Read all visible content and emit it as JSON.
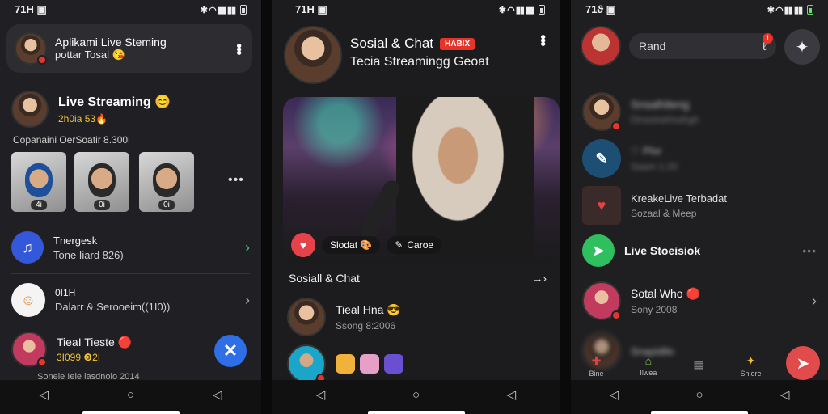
{
  "screen1": {
    "status": {
      "time": "71H ▣"
    },
    "top_card": {
      "title": "Aplikami Live Steming",
      "subtitle": "pottar Tosal 😘"
    },
    "section": {
      "title": "Live Streaming 😊",
      "meta": "2h0ia 53🔥",
      "caption": "Copanaini OerSoatir 8.300i"
    },
    "thumbs": [
      {
        "count": "4i"
      },
      {
        "count": "0i"
      },
      {
        "count": "0i"
      }
    ],
    "rows": [
      {
        "title": "Tnergesk",
        "subtitle": "Tone Iiard 826)"
      },
      {
        "title": "0I1H",
        "subtitle": "Dalarr & Serooeim((1I0))"
      },
      {
        "title": "TieaI Tieste 🔴",
        "subtitle": "3I099 ❽2I"
      }
    ],
    "bottom_caption": "Soneie Ieie lasdnoio 2014",
    "fab_label": "✕"
  },
  "screen2": {
    "status": {
      "time": "71H ▣"
    },
    "header": {
      "title": "Sosial & Chat",
      "tag": "HABIX",
      "subtitle": "Tecia Streamingg Geoat"
    },
    "hero": {
      "btn1": "Slodat 🎨",
      "btn2": "Caroe"
    },
    "section": {
      "title": "Sosiall  & Chat",
      "action": "→›"
    },
    "post": {
      "title": "Tieal Hna 😎",
      "subtitle": "Ssong 8:2006"
    }
  },
  "screen3": {
    "status": {
      "time": "71ϑ ▣"
    },
    "search": {
      "placeholder": "Rand",
      "badge": "1"
    },
    "rows": [
      {
        "title": "Snsalhileng",
        "subtitle": "Diraolodrloahgh"
      },
      {
        "title": "♡ Plor",
        "subtitle": "Saam 1:20"
      },
      {
        "title": "KreakeLive Terbadat",
        "subtitle": "Sozaal & Meep"
      },
      {
        "title": "Live Stoeisiok",
        "subtitle": ""
      },
      {
        "title": "Sotal Who 🔴",
        "subtitle": "Sony 2008"
      },
      {
        "title": "Snapidilo",
        "subtitle": ""
      }
    ],
    "dock": [
      "Bine",
      "Ilwea",
      "",
      "Shiere"
    ]
  },
  "colors": {
    "accent_blue": "#2e6ee6",
    "accent_red": "#e5352b",
    "accent_green": "#2fbf5e"
  }
}
